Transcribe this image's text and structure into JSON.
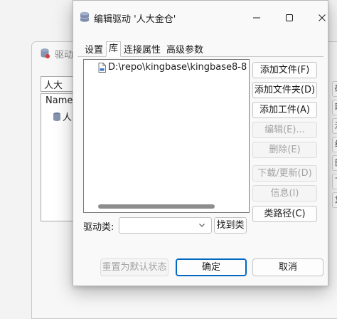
{
  "background_window": {
    "title": "驱动",
    "filter_value": "人大",
    "tree_header": "Name",
    "tree_item": "人",
    "right_buttons": [
      "确",
      "取",
      "添",
      "编",
      "删",
      "下",
      "复"
    ]
  },
  "dialog": {
    "title": "编辑驱动 '人大金仓'",
    "tabs": [
      {
        "label": "设置",
        "active": false
      },
      {
        "label": "库",
        "active": true
      },
      {
        "label": "连接属性",
        "active": false
      },
      {
        "label": "高级参数",
        "active": false
      }
    ],
    "library_items": [
      "D:\\repo\\kingbase\\kingbase8-8"
    ],
    "side_buttons": {
      "add_file": {
        "label": "添加文件(F)",
        "enabled": true
      },
      "add_folder": {
        "label": "添加文件夹(D)",
        "enabled": true
      },
      "add_artifact": {
        "label": "添加工件(A)",
        "enabled": true
      },
      "edit": {
        "label": "编辑(E)...",
        "enabled": false
      },
      "delete": {
        "label": "删除(E)",
        "enabled": false
      },
      "download_update": {
        "label": "下载/更新(D)",
        "enabled": false
      },
      "info": {
        "label": "信息(I)",
        "enabled": false
      },
      "class_path": {
        "label": "类路径(C)",
        "enabled": true
      }
    },
    "driver_class_label": "驱动类:",
    "driver_class_value": "",
    "find_class_button": "找到类",
    "reset_button": "重置为默认状态",
    "ok_button": "确定",
    "cancel_button": "取消"
  },
  "colors": {
    "accent": "#0067c0",
    "disabled_text": "#a3a3a3",
    "db_icon": "#6b7a99"
  }
}
